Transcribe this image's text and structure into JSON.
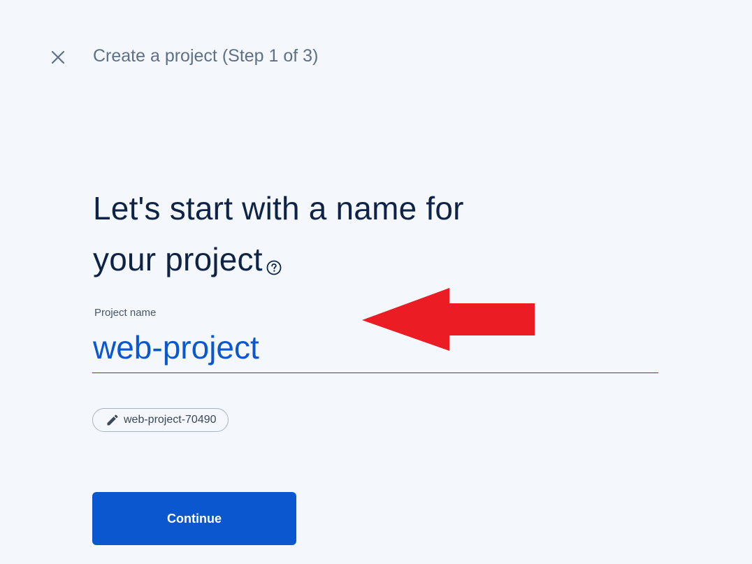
{
  "header": {
    "title": "Create a project (Step 1 of 3)",
    "close_icon": "close-icon"
  },
  "main": {
    "heading_line1": "Let's start with a name for",
    "heading_line2": "your project",
    "help_icon": "help-circle-icon",
    "project_name_field": {
      "label": "Project name",
      "value": "web-project"
    },
    "project_id_chip": {
      "icon": "pencil-icon",
      "label": "web-project-70490"
    },
    "continue_label": "Continue"
  },
  "annotation": {
    "arrow_color": "#ec1c24"
  },
  "colors": {
    "background": "#f4f8fc",
    "primary": "#0b57d0",
    "heading": "#0f2346"
  }
}
